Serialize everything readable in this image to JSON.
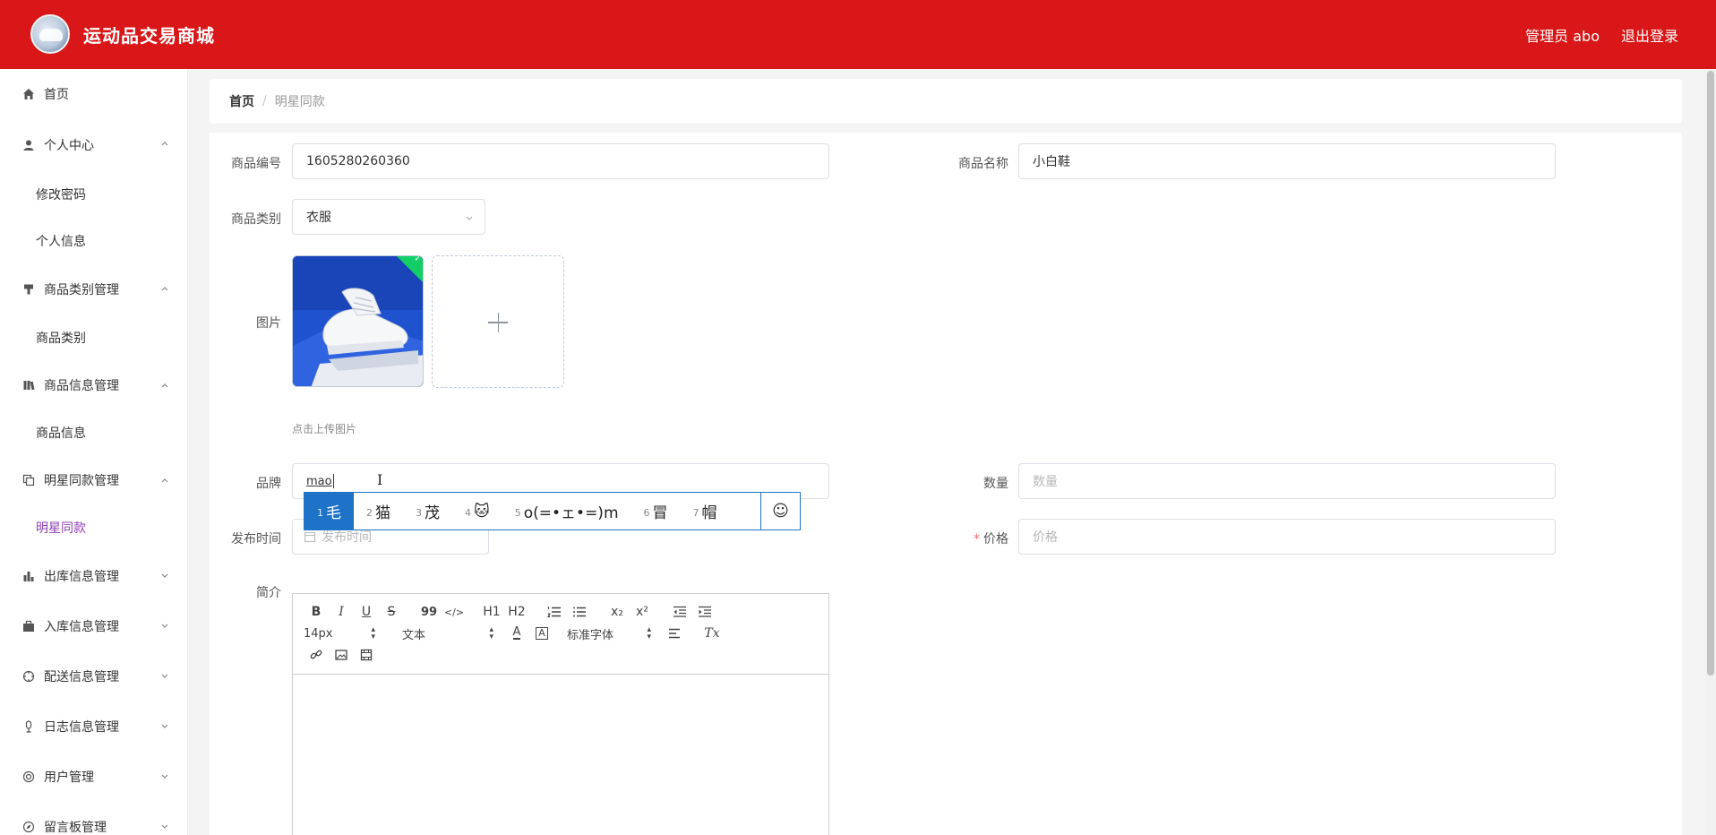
{
  "header": {
    "app_title": "运动品交易商城",
    "admin_label": "管理员 abo",
    "logout_label": "退出登录"
  },
  "sidebar": {
    "home": "首页",
    "personal_center": "个人中心",
    "change_password": "修改密码",
    "personal_info": "个人信息",
    "category_mgmt": "商品类别管理",
    "category": "商品类别",
    "product_mgmt": "商品信息管理",
    "product_info": "商品信息",
    "celebrity_mgmt": "明星同款管理",
    "celebrity_item": "明星同款",
    "outbound_mgmt": "出库信息管理",
    "inbound_mgmt": "入库信息管理",
    "delivery_mgmt": "配送信息管理",
    "log_mgmt": "日志信息管理",
    "user_mgmt": "用户管理",
    "message_mgmt": "留言板管理"
  },
  "breadcrumb": {
    "home": "首页",
    "sep": "/",
    "current": "明星同款"
  },
  "form": {
    "product_no_label": "商品编号",
    "product_no_value": "1605280260360",
    "product_name_label": "商品名称",
    "product_name_value": "小白鞋",
    "category_label": "商品类别",
    "category_value": "衣服",
    "image_label": "图片",
    "upload_hint": "点击上传图片",
    "brand_label": "品牌",
    "brand_value": "mao",
    "quantity_label": "数量",
    "quantity_placeholder": "数量",
    "publish_time_label": "发布时间",
    "publish_time_placeholder": "发布时间",
    "price_required": "*",
    "price_label": "价格",
    "price_placeholder": "价格",
    "intro_label": "简介"
  },
  "ime": {
    "candidates": [
      {
        "num": "1",
        "text": "毛"
      },
      {
        "num": "2",
        "text": "猫"
      },
      {
        "num": "3",
        "text": "茂"
      },
      {
        "num": "4",
        "text": "🐱"
      },
      {
        "num": "5",
        "text": "o(=•ェ•=)m"
      },
      {
        "num": "6",
        "text": "冒"
      },
      {
        "num": "7",
        "text": "帽"
      }
    ],
    "emoji_button": "☺"
  },
  "editor": {
    "font_size": "14px",
    "text_style": "文本",
    "font_family": "标准字体",
    "h1": "H1",
    "h2": "H2",
    "bold": "B",
    "italic": "I",
    "underline": "U",
    "strike": "S",
    "quote": "99",
    "code": "</>",
    "sub": "x₂",
    "sup": "x²",
    "clear": "Tx"
  }
}
